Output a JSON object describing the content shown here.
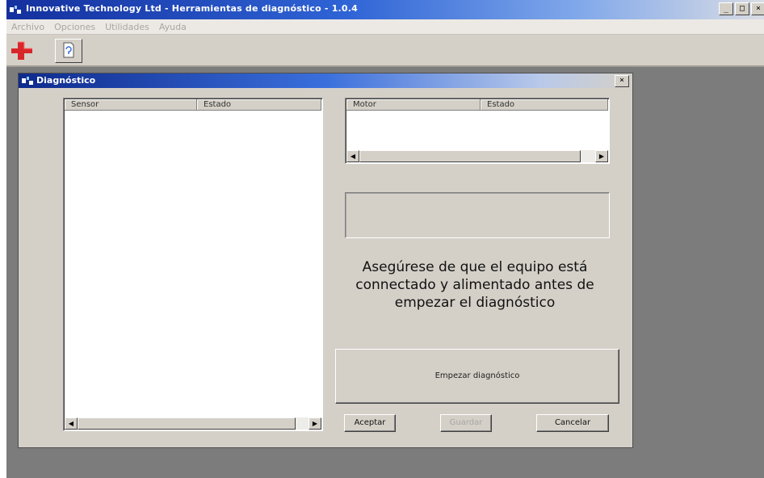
{
  "app": {
    "title": "Innovative Technology Ltd - Herramientas de diagnóstico - 1.0.4",
    "window_controls": {
      "minimize": "_",
      "maximize": "□",
      "close": "×"
    }
  },
  "menu": {
    "items": [
      "Archivo",
      "Opciones",
      "Utilidades",
      "Ayuda"
    ]
  },
  "toolbar": {
    "buttons": [
      {
        "icon": "red-arrow-icon"
      },
      {
        "icon": "document-icon"
      }
    ]
  },
  "dialog": {
    "title": "Diagnóstico",
    "close_label": "×",
    "sensor_list": {
      "columns": [
        "Sensor",
        "Estado"
      ]
    },
    "motor_list": {
      "columns": [
        "Motor",
        "Estado"
      ]
    },
    "message": "Asegúrese de que el equipo está connectado y alimentado antes de empezar el diagnóstico",
    "start_button": "Empezar diagnóstico",
    "buttons": {
      "accept": "Aceptar",
      "save": "Guardar",
      "cancel": "Cancelar"
    }
  },
  "colors": {
    "titlebar": "#14309e",
    "workspace": "#7c7c7c",
    "face": "#d4d0c8"
  }
}
